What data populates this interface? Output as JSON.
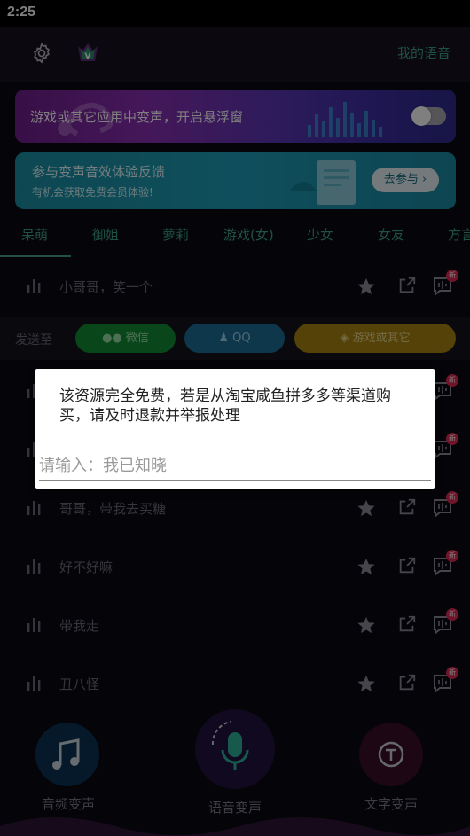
{
  "status_bar": {
    "time": "2:25"
  },
  "header": {
    "my_voice": "我的语音",
    "icons": [
      "gear-icon",
      "vip-crown-icon"
    ]
  },
  "floating_banner": {
    "text": "游戏或其它应用中变声，开启悬浮窗",
    "toggle_on": false
  },
  "feedback_banner": {
    "title": "参与变声音效体验反馈",
    "subtitle": "有机会获取免费会员体验!",
    "button": "去参与 ›"
  },
  "tabs": [
    "呆萌",
    "御姐",
    "萝莉",
    "游戏(女)",
    "少女",
    "女友",
    "方言"
  ],
  "active_tab": 0,
  "send_bar": {
    "label": "发送至",
    "wechat": "微信",
    "qq": "QQ",
    "game": "游戏或其它"
  },
  "voice_list": [
    {
      "text": "小哥哥，笑一个"
    },
    {
      "text": ""
    },
    {
      "text": ""
    },
    {
      "text": "哥哥，带我去买糖"
    },
    {
      "text": "好不好嘛"
    },
    {
      "text": "带我走"
    },
    {
      "text": "丑八怪"
    }
  ],
  "badge": "新",
  "bottom_nav": {
    "audio": "音频变声",
    "voice": "语音变声",
    "text": "文字变声"
  },
  "dialog": {
    "message": "该资源完全免费，若是从淘宝咸鱼拼多多等渠道购买，请及时退款并举报处理",
    "placeholder": "请输入：我已知晓"
  },
  "colors": {
    "accent": "#3fa38a",
    "wechat": "#128c35",
    "qq": "#1d6f97",
    "game": "#a88413",
    "badge": "#e02a52"
  }
}
